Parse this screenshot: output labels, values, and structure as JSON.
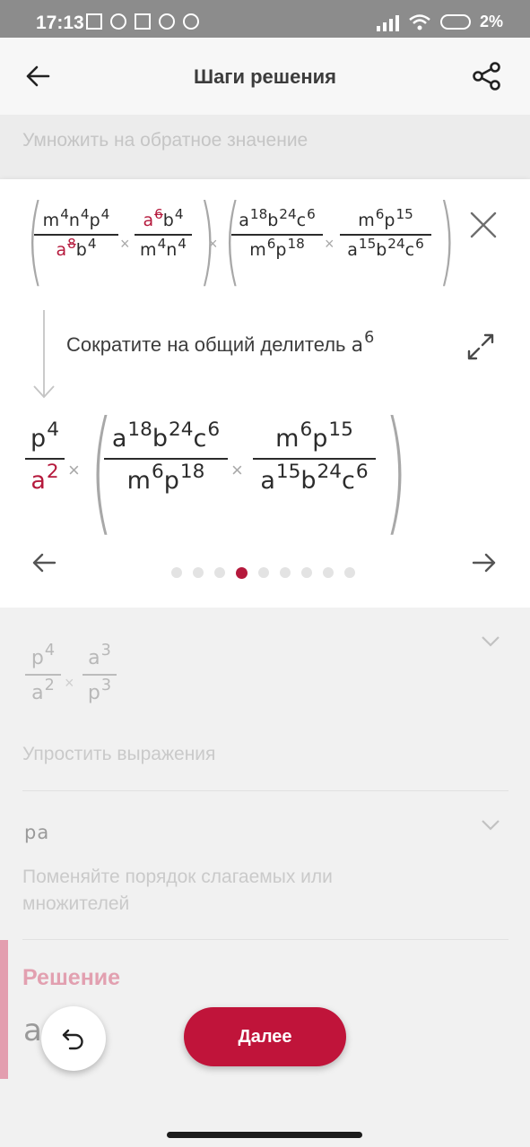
{
  "status_bar": {
    "time": "17:13",
    "battery": "2%"
  },
  "app_bar": {
    "title": "Шаги решения"
  },
  "prev_step_label": "Умножить на обратное значение",
  "card": {
    "top_expression": {
      "g1": {
        "f1": {
          "num": [
            "m",
            "4",
            "n",
            "4",
            "p",
            "4"
          ],
          "den": [
            "a",
            "8",
            "b",
            "4"
          ]
        },
        "f2": {
          "num": [
            "a",
            "6",
            "b",
            "4"
          ],
          "den": [
            "m",
            "4",
            "n",
            "4"
          ]
        }
      },
      "g2": {
        "f1": {
          "num": [
            "a",
            "18",
            "b",
            "24",
            "c",
            "6"
          ],
          "den": [
            "m",
            "6",
            "p",
            "18"
          ]
        },
        "f2": {
          "num": [
            "m",
            "6",
            "p",
            "15"
          ],
          "den": [
            "a",
            "15",
            "b",
            "24",
            "c",
            "6"
          ]
        }
      }
    },
    "hint_text": "Сократите на общий делитель",
    "hint_math": {
      "base": "a",
      "exp": "6"
    },
    "result_expression": {
      "f0": {
        "num": [
          "p",
          "4"
        ],
        "den": [
          "a",
          "2"
        ]
      },
      "f1": {
        "num": [
          "a",
          "18",
          "b",
          "24",
          "c",
          "6"
        ],
        "den": [
          "m",
          "6",
          "p",
          "18"
        ]
      },
      "f2": {
        "num": [
          "m",
          "6",
          "p",
          "15"
        ],
        "den": [
          "a",
          "15",
          "b",
          "24",
          "c",
          "6"
        ]
      }
    },
    "pager": {
      "total": 9,
      "active_index": 3
    }
  },
  "next_steps": [
    {
      "expr": {
        "f1": {
          "num": [
            "p",
            "4"
          ],
          "den": [
            "a",
            "2"
          ]
        },
        "f2": {
          "num": [
            "a",
            "3"
          ],
          "den": [
            "p",
            "3"
          ]
        }
      },
      "label": "Упростить выражения"
    },
    {
      "value": "pa",
      "label": "Поменяйте порядок слагаемых или множителей"
    }
  ],
  "solution": {
    "title": "Решение",
    "value": "a"
  },
  "buttons": {
    "next": "Далее"
  },
  "colors": {
    "accent": "#c0143a",
    "status_bar": "#8c8c8c"
  }
}
